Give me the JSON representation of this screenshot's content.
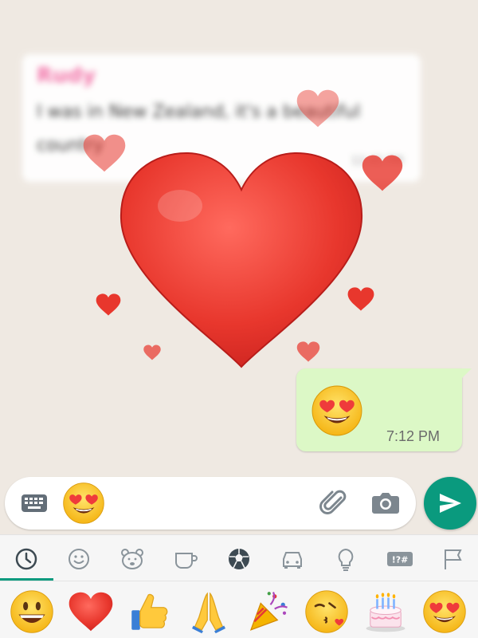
{
  "incoming_message": {
    "sender": "Rudy",
    "text": "I was in New Zealand, it's a beautiful country",
    "time": "12:45 PM"
  },
  "outgoing_message": {
    "emoji": "smiling-face-with-heart-eyes",
    "time": "7:12 PM"
  },
  "input_bar": {
    "keyboard_icon": "keyboard-icon",
    "emoji": "smiling-face-with-heart-eyes",
    "attach_icon": "paperclip-icon",
    "camera_icon": "camera-icon",
    "send_icon": "send-icon"
  },
  "emoji_categories": [
    {
      "name": "recent",
      "icon": "clock-icon",
      "selected": true
    },
    {
      "name": "smileys",
      "icon": "smiley-icon",
      "selected": false
    },
    {
      "name": "animals",
      "icon": "bear-icon",
      "selected": false
    },
    {
      "name": "food",
      "icon": "cup-icon",
      "selected": false
    },
    {
      "name": "activities",
      "icon": "soccer-ball-icon",
      "selected": false
    },
    {
      "name": "travel",
      "icon": "car-icon",
      "selected": false
    },
    {
      "name": "objects",
      "icon": "lightbulb-icon",
      "selected": false
    },
    {
      "name": "symbols",
      "icon": "symbols-icon",
      "label": "!?#",
      "selected": false
    },
    {
      "name": "flags",
      "icon": "flag-icon",
      "selected": false
    }
  ],
  "recent_emojis": [
    "grinning-face",
    "red-heart",
    "thumbs-up",
    "folded-hands",
    "party-popper",
    "face-blowing-kiss",
    "birthday-cake",
    "smiling-face-with-heart-eyes"
  ],
  "colors": {
    "accent": "#0a9a7e",
    "outgoing_bubble": "#dcf8c6",
    "heart_red": "#e3342f",
    "chat_bg": "#efe9e2"
  }
}
